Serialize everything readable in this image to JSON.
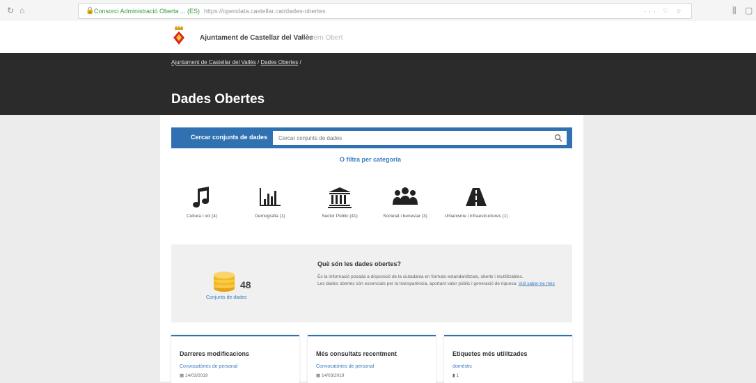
{
  "browser": {
    "site_identity": "Consorci Administració Oberta ... (ES)",
    "url": "https://opendata.castellar.cat/dades-obertes",
    "right_controls": "··· ♡ ☆"
  },
  "header": {
    "site_title": "Ajuntament de Castellar del Vallès",
    "site_subtitle": "Govern Obert"
  },
  "hero": {
    "breadcrumb_home": "Ajuntament de Castellar del Vallès",
    "breadcrumb_sep": "/",
    "breadcrumb_current": "Dades Obertes",
    "breadcrumb_trail": "/",
    "page_title": "Dades Obertes"
  },
  "search": {
    "label": "Cercar conjunts de dades",
    "placeholder": "Cercar conjunts de dades"
  },
  "filter_link": "O filtra per categoria",
  "categories": [
    {
      "label": "Cultura i oci (4)",
      "icon": "music-note-icon"
    },
    {
      "label": "Demografia (1)",
      "icon": "bar-chart-icon"
    },
    {
      "label": "Sector Públic (41)",
      "icon": "public-building-icon"
    },
    {
      "label": "Societat i benestar (3)",
      "icon": "people-icon"
    },
    {
      "label": "Urbanisme i infraestructures (1)",
      "icon": "road-icon"
    }
  ],
  "info": {
    "count": "48",
    "count_label": "Conjunts de dades",
    "title": "Què són les dades obertes?",
    "text1": "És la informació posada a disposició de la ciutadania en formats estandarditzats, oberts i reutilitzables.",
    "text2": "Les dades obertes són essencials per la transparència, aportant valor públic i generació de riquesa.",
    "more": "Vull saber-ne més"
  },
  "cards": [
    {
      "title": "Darreres modificacions",
      "link": "Convocatòries de personal",
      "date": "14/03/2019"
    },
    {
      "title": "Més consultats recentment",
      "link": "Convocatòries de personal",
      "date": "14/03/2019"
    },
    {
      "title": "Etiquetes més utilitzades",
      "link": "doméstic",
      "date": "1"
    }
  ],
  "colors": {
    "accent": "#2f71b1",
    "hero": "#2b2b2b",
    "coin": "#f5b81c"
  }
}
